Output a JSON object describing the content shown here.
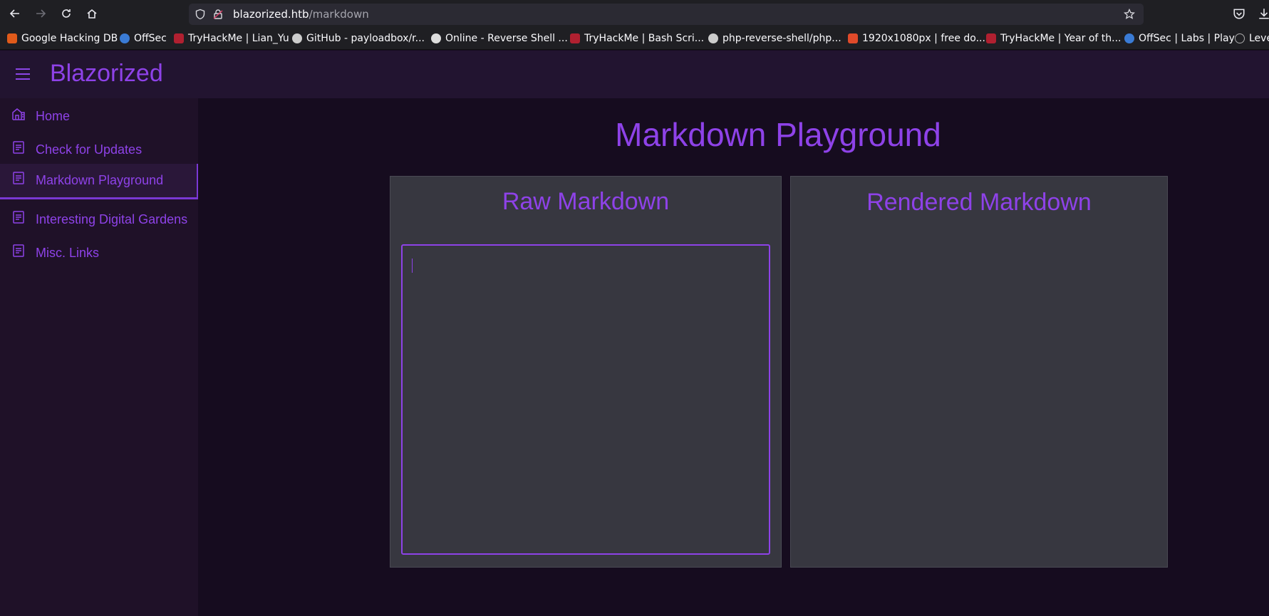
{
  "browser": {
    "url_host": "blazorized.htb",
    "url_path": "/markdown",
    "icons": [
      "back-arrow-icon",
      "forward-arrow-icon",
      "reload-icon",
      "home-icon",
      "shield-icon",
      "lock-icon",
      "star-icon",
      "pocket-icon",
      "download-icon"
    ],
    "bookmarks": [
      {
        "label": "Google Hacking DB",
        "color": "#e05a1a"
      },
      {
        "label": "OffSec",
        "color": "#3a7bd5"
      },
      {
        "label": "TryHackMe | Lian_Yu",
        "color": "#b02030"
      },
      {
        "label": "GitHub - payloadbox/r...",
        "color": "#cccccc"
      },
      {
        "label": "Online - Reverse Shell ...",
        "color": "#dddddd"
      },
      {
        "label": "TryHackMe | Bash Scri...",
        "color": "#b02030"
      },
      {
        "label": "php-reverse-shell/php...",
        "color": "#cccccc"
      },
      {
        "label": "1920x1080px | free do...",
        "color": "#e04a2a"
      },
      {
        "label": "TryHackMe | Year of th...",
        "color": "#b02030"
      },
      {
        "label": "OffSec | Labs | Play",
        "color": "#3a7bd5"
      },
      {
        "label": "Leve",
        "color": "#aaaaaa"
      }
    ]
  },
  "app": {
    "brand": "Blazorized",
    "accent_color": "#8e42e8",
    "sidebar": {
      "items": [
        {
          "label": "Home",
          "icon": "home-building-icon",
          "active": false
        },
        {
          "label": "Check for Updates",
          "icon": "document-icon",
          "active": false
        },
        {
          "label": "Markdown Playground",
          "icon": "document-icon",
          "active": true
        },
        {
          "label": "Interesting Digital Gardens",
          "icon": "document-icon",
          "active": false
        },
        {
          "label": "Misc. Links",
          "icon": "document-icon",
          "active": false
        }
      ]
    },
    "main": {
      "title": "Markdown Playground",
      "raw_panel_title": "Raw Markdown",
      "rendered_panel_title": "Rendered Markdown",
      "editor_value": ""
    }
  }
}
